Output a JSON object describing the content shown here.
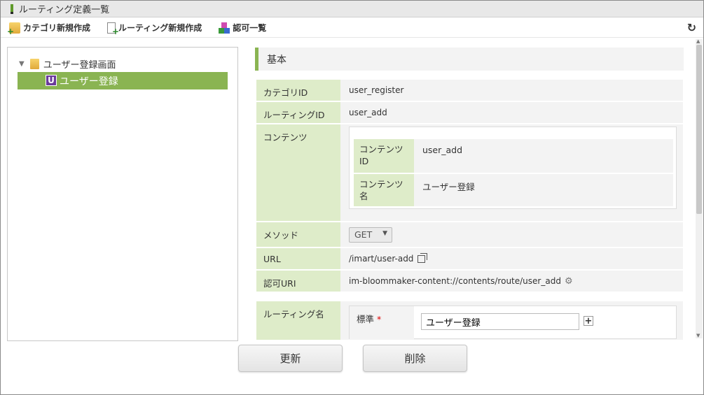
{
  "window": {
    "title": "ルーティング定義一覧"
  },
  "toolbar": {
    "category_new": "カテゴリ新規作成",
    "routing_new": "ルーティング新規作成",
    "auth_list": "認可一覧"
  },
  "tree": {
    "root_label": "ユーザー登録画面",
    "leaf_badge": "U",
    "leaf_label": "ユーザー登録"
  },
  "section": {
    "title": "基本"
  },
  "fields": {
    "category_id_label": "カテゴリID",
    "category_id_value": "user_register",
    "routing_id_label": "ルーティングID",
    "routing_id_value": "user_add",
    "contents_label": "コンテンツ",
    "contents_id_label": "コンテンツ\nID",
    "contents_id_value": "user_add",
    "contents_name_label": "コンテンツ\n名",
    "contents_name_value": "ユーザー登録",
    "method_label": "メソッド",
    "method_value": "GET",
    "url_label": "URL",
    "url_value": "/imart/user-add",
    "auth_uri_label": "認可URI",
    "auth_uri_value": "im-bloommaker-content://contents/route/user_add",
    "routing_name_label": "ルーティング名",
    "standard_label": "標準",
    "required_mark": "*",
    "routing_name_value": "ユーザー登録"
  },
  "buttons": {
    "update": "更新",
    "delete": "削除"
  },
  "colors": {
    "accent": "#8ab452",
    "label_bg": "#deecc9"
  }
}
